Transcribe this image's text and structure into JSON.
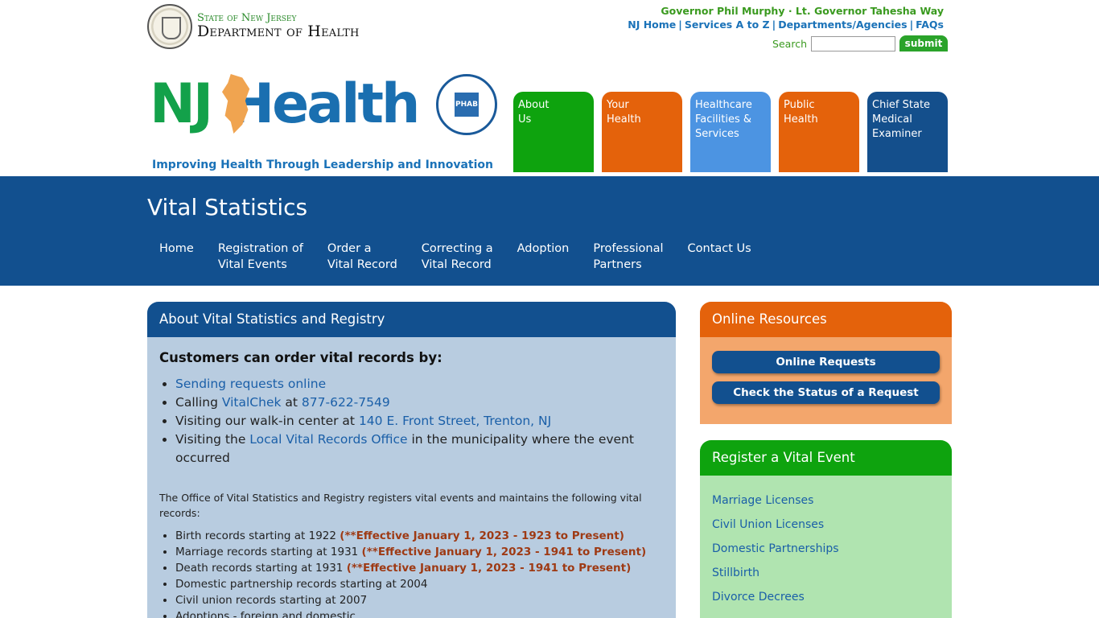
{
  "header": {
    "state_line": "State of New Jersey",
    "dept_line": "Department of Health",
    "governor_line": "Governor Phil Murphy · Lt. Governor Tahesha Way",
    "util_links": [
      "NJ Home",
      "Services A to Z",
      "Departments/Agencies",
      "FAQs"
    ],
    "search_label": "Search",
    "search_value": "",
    "search_button": "submit",
    "logo_nj": "NJ",
    "logo_health": "Health",
    "phab_badge": "PHAB",
    "tagline": "Improving Health Through Leadership and Innovation"
  },
  "tiles": [
    {
      "line1": "About",
      "line2": "Us",
      "line3": "",
      "color": "#0ea30e"
    },
    {
      "line1": "Your",
      "line2": "Health",
      "line3": "",
      "color": "#e4620b"
    },
    {
      "line1": "Healthcare",
      "line2": "Facilities &",
      "line3": "Services",
      "color": "#4c94e2"
    },
    {
      "line1": "Public",
      "line2": "Health",
      "line3": "",
      "color": "#e4620b"
    },
    {
      "line1": "Chief State",
      "line2": "Medical",
      "line3": "Examiner",
      "color": "#144f8c"
    }
  ],
  "banner": {
    "title": "Vital Statistics",
    "subnav": [
      {
        "line1": "Home",
        "line2": ""
      },
      {
        "line1": "Registration of",
        "line2": "Vital Events"
      },
      {
        "line1": "Order a",
        "line2": "Vital Record"
      },
      {
        "line1": "Correcting a",
        "line2": "Vital Record"
      },
      {
        "line1": "Adoption",
        "line2": ""
      },
      {
        "line1": "Professional",
        "line2": "Partners"
      },
      {
        "line1": "Contact Us",
        "line2": ""
      }
    ]
  },
  "main": {
    "panel_title": "About Vital Statistics and Registry",
    "customers_heading": "Customers can order vital records by:",
    "order_methods": {
      "m1_link": "Sending requests online",
      "m2_pre": "Calling ",
      "m2_link": "VitalChek",
      "m2_mid": " at ",
      "m2_phone": "877-622-7549",
      "m3_pre": "Visiting our walk-in center at ",
      "m3_link": "140 E. Front Street, Trenton, NJ",
      "m4_pre": "Visiting the ",
      "m4_link": "Local Vital Records Office",
      "m4_post": " in the municipality where the event occurred"
    },
    "intro": "The Office of Vital Statistics and Registry registers vital events and maintains the following vital records:",
    "records": [
      {
        "text": "Birth records starting at 1922 ",
        "note": "(**Effective January 1, 2023 - 1923 to Present)"
      },
      {
        "text": "Marriage records starting at 1931 ",
        "note": "(**Effective January 1, 2023 - 1941 to Present)"
      },
      {
        "text": "Death records starting at 1931 ",
        "note": "(**Effective January 1, 2023 - 1941 to Present)"
      },
      {
        "text": "Domestic partnership records starting at 2004",
        "note": ""
      },
      {
        "text": "Civil union records starting at 2007",
        "note": ""
      },
      {
        "text": "Adoptions - foreign and domestic",
        "note": ""
      }
    ]
  },
  "online_resources": {
    "title": "Online Resources",
    "buttons": [
      "Online Requests",
      "Check the Status of a Request"
    ]
  },
  "register": {
    "title": "Register a Vital Event",
    "links": [
      "Marriage Licenses",
      "Civil Union Licenses",
      "Domestic Partnerships",
      "Stillbirth",
      "Divorce Decrees"
    ]
  }
}
